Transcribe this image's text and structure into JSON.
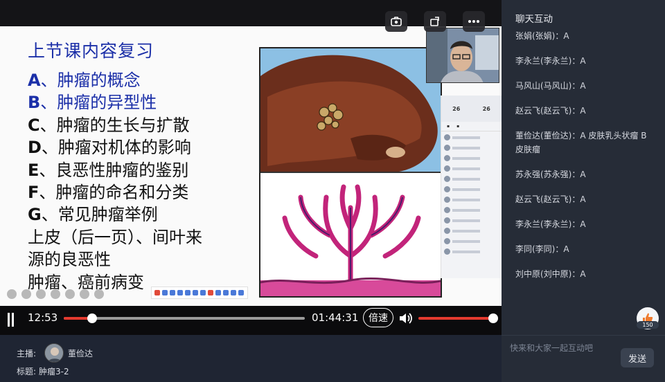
{
  "slide": {
    "title": "上节课内容复习",
    "items": [
      {
        "letter": "A",
        "text": "、肿瘤的概念",
        "highlight": true
      },
      {
        "letter": "B",
        "text": "、肿瘤的异型性",
        "highlight": true
      },
      {
        "letter": "C",
        "text": "、肿瘤的生长与扩散",
        "highlight": false
      },
      {
        "letter": "D",
        "text": "、肿瘤对机体的影响",
        "highlight": false
      },
      {
        "letter": "E",
        "text": "、良恶性肿瘤的鉴别",
        "highlight": false
      },
      {
        "letter": "F",
        "text": "、肿瘤的命名和分类",
        "highlight": false
      },
      {
        "letter": "G",
        "text": "、常见肿瘤举例",
        "highlight": false
      },
      {
        "letter": "",
        "text": "上皮（后一页）、间叶来",
        "highlight": false
      },
      {
        "letter": "",
        "text": "源的良恶性",
        "highlight": false
      },
      {
        "letter": "",
        "text": "肿瘤、癌前病变",
        "highlight": false
      }
    ],
    "embedded_chat": {
      "stat_a": "26",
      "stat_b": "26"
    }
  },
  "player": {
    "current_time": "12:53",
    "total_time": "01:44:31",
    "progress_fraction": 0.118,
    "speed_label": "倍速",
    "volume_fraction": 1.0
  },
  "info": {
    "host_label": "主播:",
    "host_name": "董俭达",
    "title_label": "标题:",
    "title_value": "肿瘤3-2"
  },
  "chat": {
    "title": "聊天互动",
    "messages": [
      "张娟(张娟)：A",
      "李永兰(李永兰)：A",
      "马风山(马风山)：A",
      "赵云飞(赵云飞)：A",
      "董俭达(董俭达)：A 皮肤乳头状瘤 B 皮肤瘤",
      "苏永强(苏永强)：A",
      "赵云飞(赵云飞)：A",
      "李永兰(李永兰)：A",
      "李同(李同)：A",
      "刘中原(刘中原)：A"
    ],
    "input_placeholder": "快来和大家一起互动吧",
    "send_label": "发送",
    "like_count": "150"
  },
  "colors": {
    "accent_red": "#e43a2f",
    "slide_blue": "#1b2fa8",
    "chat_bg": "#262c37"
  }
}
